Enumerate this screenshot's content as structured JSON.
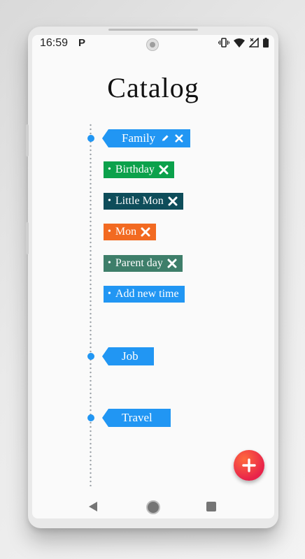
{
  "status": {
    "time": "16:59",
    "notif_glyph": "P"
  },
  "page": {
    "title": "Catalog"
  },
  "categories": [
    {
      "name": "Family",
      "color": "#2196F3",
      "editable": true,
      "items": [
        {
          "label": "Birthday",
          "color": "#0BA14B",
          "removable": true
        },
        {
          "label": "Little Mon",
          "color": "#0E4D5A",
          "removable": true
        },
        {
          "label": "Mon",
          "color": "#F26A21",
          "removable": true
        },
        {
          "label": "Parent day",
          "color": "#3E7E6A",
          "removable": true
        },
        {
          "label": "Add new time",
          "color": "#2196F3",
          "removable": false
        }
      ]
    },
    {
      "name": "Job",
      "color": "#2196F3"
    },
    {
      "name": "Travel",
      "color": "#2196F3"
    }
  ],
  "fab": {
    "icon": "plus-icon"
  },
  "icons": {
    "edit": "pen-icon",
    "remove": "close-x-icon",
    "nav": [
      "back-triangle-icon",
      "home-circle-icon",
      "recents-square-icon"
    ],
    "status": [
      "vibrate-icon",
      "wifi-icon",
      "no-signal-icon",
      "battery-icon"
    ]
  }
}
